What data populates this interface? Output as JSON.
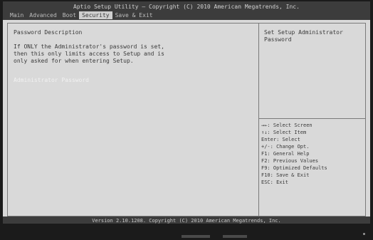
{
  "header": {
    "title": "Aptio Setup Utility – Copyright (C) 2010 American Megatrends, Inc.",
    "tabs": [
      {
        "label": "Main",
        "active": false
      },
      {
        "label": "Advanced",
        "active": false
      },
      {
        "label": "Boot",
        "active": false
      },
      {
        "label": "Security",
        "active": true
      },
      {
        "label": "Save & Exit",
        "active": false
      }
    ]
  },
  "main": {
    "section_title": "Password Description",
    "info_lines": [
      "If ONLY the Administrator's password is set,",
      "then this only limits access to Setup and is",
      "only asked for when entering Setup."
    ],
    "admin_password_label": "Administrator Password"
  },
  "help": {
    "text": "Set Setup Administrator Password",
    "keys": [
      "→←: Select Screen",
      "↑↓: Select Item",
      "Enter: Select",
      "+/-: Change Opt.",
      "F1: General Help",
      "F2: Previous Values",
      "F9: Optimized Defaults",
      "F10: Save & Exit",
      "ESC: Exit"
    ]
  },
  "footer": {
    "version": "Version 2.10.1208. Copyright (C) 2010 American Megatrends, Inc."
  },
  "colors": {
    "background": "#d9d9d9",
    "bar": "#3c3c3c",
    "highlight": "#f2f2f2"
  }
}
